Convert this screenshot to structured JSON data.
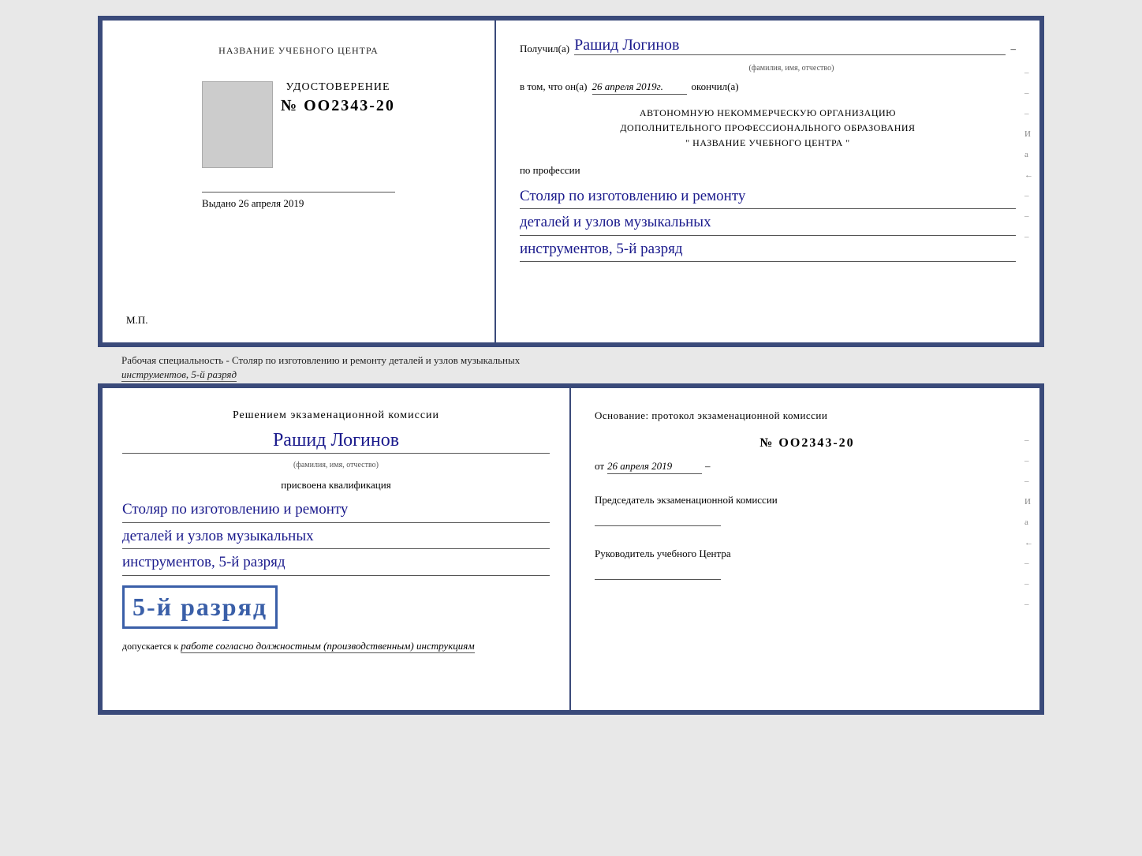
{
  "top_doc": {
    "left": {
      "center_title": "НАЗВАНИЕ УЧЕБНОГО ЦЕНТРА",
      "udost_label": "УДОСТОВЕРЕНИЕ",
      "udost_number": "№ OO2343-20",
      "vydano_label": "Выдано",
      "vydano_date": "26 апреля 2019",
      "mp_label": "М.П."
    },
    "right": {
      "poluchil_label": "Получил(а)",
      "recipient_name": "Рашид Логинов",
      "name_subtitle": "(фамилия, имя, отчество)",
      "vtom_label": "в том, что он(а)",
      "vtom_date": "26 апреля 2019г.",
      "okonchil_label": "окончил(а)",
      "org_line1": "АВТОНОМНУЮ НЕКОММЕРЧЕСКУЮ ОРГАНИЗАЦИЮ",
      "org_line2": "ДОПОЛНИТЕЛЬНОГО ПРОФЕССИОНАЛЬНОГО ОБРАЗОВАНИЯ",
      "org_line3": "\"    НАЗВАНИЕ УЧЕБНОГО ЦЕНТРА    \"",
      "profession_label": "по профессии",
      "profession_line1": "Столяр по изготовлению и ремонту",
      "profession_line2": "деталей и узлов музыкальных",
      "profession_line3": "инструментов, 5-й разряд"
    },
    "right_decoration": [
      "-",
      "-",
      "-",
      "И",
      "а",
      "←",
      "-",
      "-",
      "-"
    ]
  },
  "specialty_text": "Рабочая специальность - Столяр по изготовлению и ремонту деталей и узлов музыкальных",
  "specialty_text2": "инструментов, 5-й разряд",
  "bottom_doc": {
    "left": {
      "resheniem_label": "Решением экзаменационной комиссии",
      "name_value": "Рашид Логинов",
      "name_subtitle": "(фамилия, имя, отчество)",
      "prisvoena_label": "присвоена квалификация",
      "qual_line1": "Столяр по изготовлению и ремонту",
      "qual_line2": "деталей и узлов музыкальных",
      "qual_line3": "инструментов, 5-й разряд",
      "rank_big": "5-й разряд",
      "dopuskaetsya_label": "допускается к",
      "dopuskaetsya_value": "работе согласно должностным (производственным) инструкциям"
    },
    "right": {
      "osnovanie_label": "Основание: протокол экзаменационной комиссии",
      "protocol_number": "№  OO2343-20",
      "ot_label": "от",
      "ot_date": "26 апреля 2019",
      "predsedatel_label": "Председатель экзаменационной комиссии",
      "rukovoditel_label": "Руководитель учебного Центра"
    },
    "right_decoration": [
      "-",
      "-",
      "-",
      "И",
      "а",
      "←",
      "-",
      "-",
      "-"
    ]
  }
}
